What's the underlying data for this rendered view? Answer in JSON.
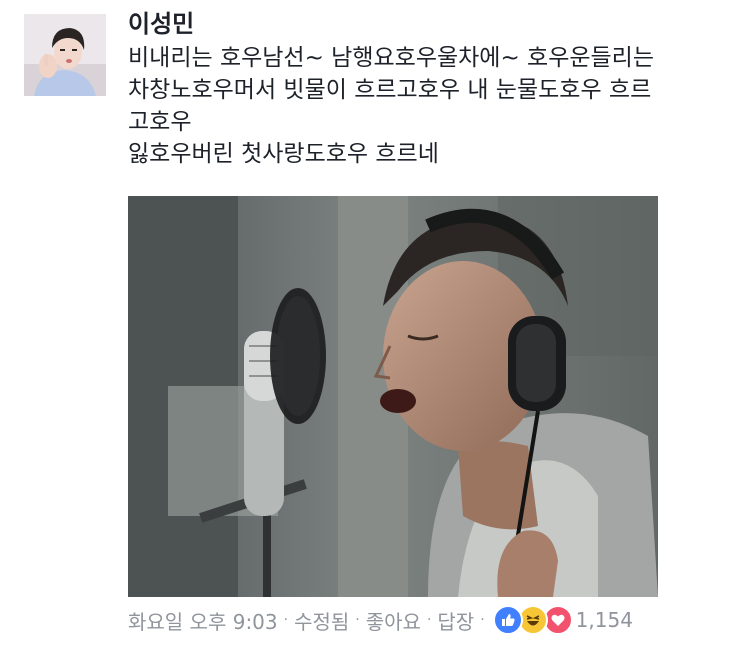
{
  "author": {
    "name": "이성민"
  },
  "comment": {
    "lines": [
      "비내리는 호우남선~ 남행요호우울차에~ 호우운들리는",
      "차창노호우머서 빗물이 흐르고호우 내 눈물도호우 흐르",
      "고호우",
      "잃호우버린 첫사랑도호우 흐르네"
    ]
  },
  "meta": {
    "timestamp": "화요일 오후 9:03",
    "edited": "수정됨",
    "like": "좋아요",
    "reply": "답장",
    "separator": "·",
    "reaction_count": "1,154",
    "reactions": [
      "like-icon",
      "haha-icon",
      "love-icon"
    ]
  },
  "colors": {
    "name": "#1d2129",
    "meta": "#90949c",
    "like": "#4080ff",
    "haha": "#f7c636",
    "love": "#f2526e"
  }
}
